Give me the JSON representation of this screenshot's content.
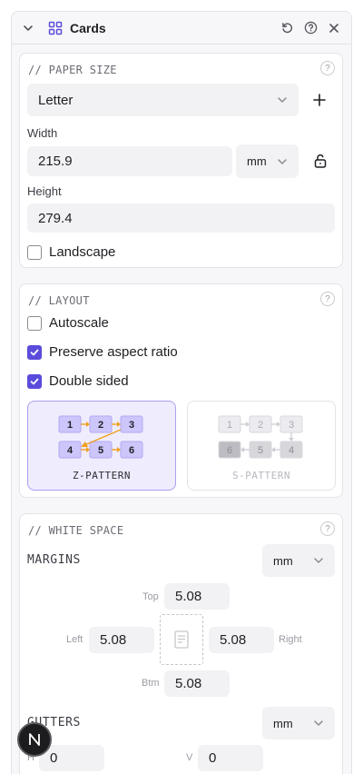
{
  "panel": {
    "title": "Cards"
  },
  "paper_size": {
    "title": "// PAPER SIZE",
    "help": "?",
    "preset": "Letter",
    "width_label": "Width",
    "width_value": "215.9",
    "unit": "mm",
    "height_label": "Height",
    "height_value": "279.4",
    "landscape_label": "Landscape",
    "landscape_checked": false
  },
  "layout": {
    "title": "// LAYOUT",
    "help": "?",
    "autoscale_label": "Autoscale",
    "autoscale_checked": false,
    "preserve_label": "Preserve aspect ratio",
    "preserve_checked": true,
    "double_sided_label": "Double sided",
    "double_sided_checked": true,
    "z_pattern_label": "Z-PATTERN",
    "s_pattern_label": "S-PATTERN",
    "z_cells_top": [
      "1",
      "2",
      "3"
    ],
    "z_cells_bottom": [
      "4",
      "5",
      "6"
    ],
    "s_cells_top": [
      "1",
      "2",
      "3"
    ],
    "s_cells_bottom": [
      "6",
      "5",
      "4"
    ]
  },
  "white_space": {
    "title": "// WHITE SPACE",
    "help": "?",
    "margins_label": "MARGINS",
    "margins_unit": "mm",
    "top_label": "Top",
    "top_value": "5.08",
    "left_label": "Left",
    "left_value": "5.08",
    "right_label": "Right",
    "right_value": "5.08",
    "btm_label": "Btm",
    "btm_value": "5.08",
    "gutters_label": "GUTTERS",
    "gutters_unit": "mm",
    "h_label": "H",
    "h_value": "0",
    "v_label": "V",
    "v_value": "0"
  },
  "fab": {
    "letter": "N"
  },
  "colors": {
    "accent": "#5b4bdb",
    "arrow": "#f0a020",
    "cell": "#cdc6fb"
  }
}
